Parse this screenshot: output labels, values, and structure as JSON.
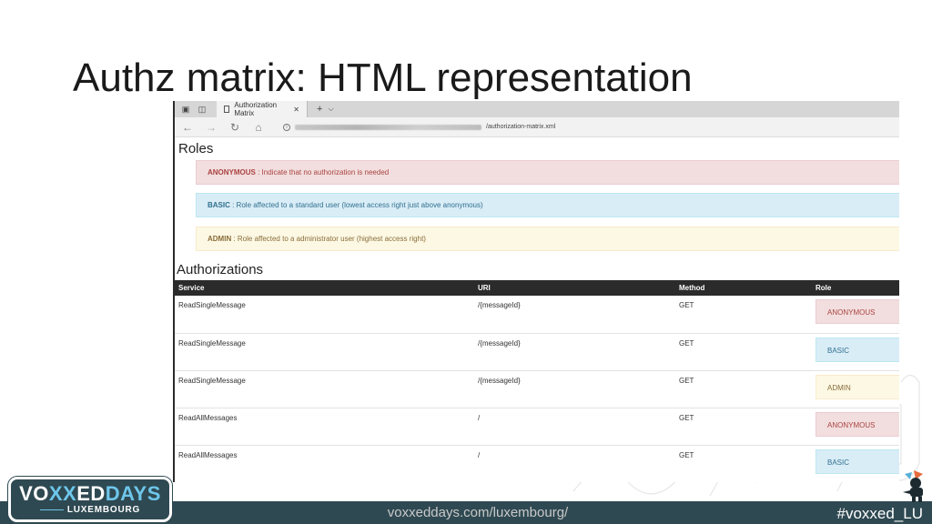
{
  "slide": {
    "title": "Authz matrix: HTML representation"
  },
  "browser": {
    "tab_title": "Authorization Matrix",
    "tab_close": "✕",
    "new_tab": "+",
    "tab_dropdown": "⌵",
    "url_visible": "/authorization-matrix.xml"
  },
  "roles": {
    "heading": "Roles",
    "items": [
      {
        "name": "ANONYMOUS",
        "desc": " : Indicate that no authorization is needed",
        "color": "#f2dede"
      },
      {
        "name": "BASIC",
        "desc": " : Role affected to a standard user (lowest access right just above anonymous)",
        "color": "#d9edf7"
      },
      {
        "name": "ADMIN",
        "desc": " : Role affected to a administrator user (highest access right)",
        "color": "#fcf8e3"
      }
    ]
  },
  "authorizations": {
    "heading": "Authorizations",
    "columns": [
      "Service",
      "URI",
      "Method",
      "Role"
    ],
    "rows": [
      {
        "service": "ReadSingleMessage",
        "uri": "/{messageId}",
        "method": "GET",
        "role": "ANONYMOUS"
      },
      {
        "service": "ReadSingleMessage",
        "uri": "/{messageId}",
        "method": "GET",
        "role": "BASIC"
      },
      {
        "service": "ReadSingleMessage",
        "uri": "/{messageId}",
        "method": "GET",
        "role": "ADMIN"
      },
      {
        "service": "ReadAllMessages",
        "uri": "/",
        "method": "GET",
        "role": "ANONYMOUS"
      },
      {
        "service": "ReadAllMessages",
        "uri": "/",
        "method": "GET",
        "role": "BASIC"
      }
    ]
  },
  "footer": {
    "url": "voxxeddays.com/luxembourg/",
    "hashtag": "#voxxed_LU",
    "logo_main_a": "VO",
    "logo_main_x": "XX",
    "logo_main_b": "ED",
    "logo_main_c": "DAYS",
    "logo_sub": "LUXEMBOURG",
    "bar_color": "#2f4952"
  }
}
